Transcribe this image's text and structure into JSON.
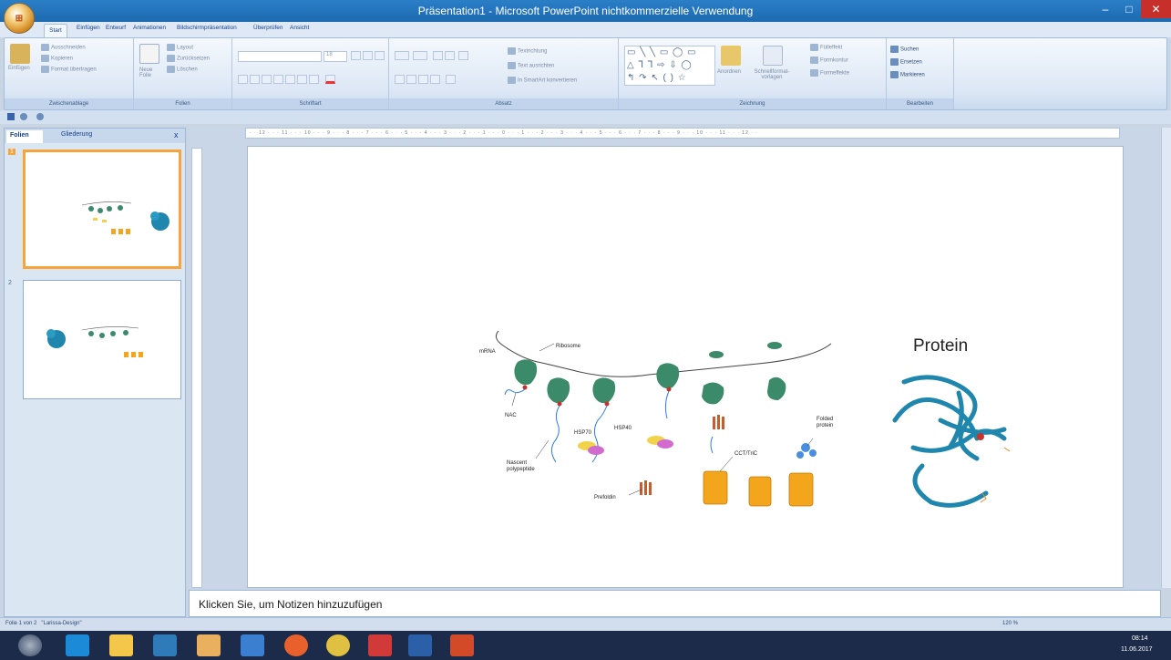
{
  "window": {
    "title": "Präsentation1 - Microsoft PowerPoint nichtkommerzielle Verwendung",
    "min": "–",
    "max": "□",
    "close": "✕",
    "office_logo": "⊞"
  },
  "tabs": [
    "Start",
    "Einfügen",
    "Entwurf",
    "Animationen",
    "Bildschirmpräsentation",
    "Überprüfen",
    "Ansicht"
  ],
  "ribbon": {
    "clipboard": {
      "paste": "Einfügen",
      "cut": "Ausschneiden",
      "copy": "Kopieren",
      "format": "Format übertragen",
      "label": "Zwischenablage"
    },
    "slides": {
      "new": "Neue Folie",
      "layout": "Layout",
      "reset": "Zurücksetzen",
      "delete": "Löschen",
      "label": "Folien"
    },
    "font": {
      "label": "Schriftart",
      "size": "18"
    },
    "paragraph": {
      "text_direction": "Textrichtung",
      "align_text": "Text ausrichten",
      "smartart": "In SmartArt konvertieren",
      "label": "Absatz"
    },
    "drawing": {
      "arrange": "Anordnen",
      "quick_styles": "Schnellformat-vorlagen",
      "fill": "Fülleffekt",
      "outline": "Formkontur",
      "effects": "Formeffekte",
      "label": "Zeichnung"
    },
    "editing": {
      "find": "Suchen",
      "replace": "Ersetzen",
      "select": "Markieren",
      "label": "Bearbeiten"
    }
  },
  "panel": {
    "tab_slides": "Folien",
    "tab_outline": "Gliederung",
    "close": "x",
    "thumbs": [
      "1",
      "2"
    ]
  },
  "ruler": "· · 12 · · · 11 · · · 10 · · · 9 · · · 8 · · · 7 · · · 6 · · · 5 · · · 4 · · · 3 · · · 2 · · · 1 · · · 0 · · · 1 · · · 2 · · · 3 · · · 4 · · · 5 · · · 6 · · · 7 · · · 8 · · · 9 · · · 10 · · · 11 · · · 12 · ·",
  "slide": {
    "protein_title": "Protein",
    "labels": {
      "mrna": "mRNA",
      "ribosome": "Ribosome",
      "nac": "NAC",
      "hsp70": "HSP70",
      "hsp40": "HSP40",
      "nascent": "Nascent polypeptide",
      "prefoldin": "Prefoldin",
      "cct": "CCT/TriC",
      "folded": "Folded protein"
    }
  },
  "notes": {
    "placeholder": "Klicken Sie, um Notizen hinzuzufügen"
  },
  "status": {
    "slide": "Folie 1 von 2",
    "theme": "\"Larissa-Design\"",
    "zoom": "120 %"
  },
  "tray": {
    "time": "08:14",
    "date": "11.06.2017"
  },
  "colors": {
    "title_bar": "#1d6ab0",
    "ribosome": "#3b8a6a",
    "protein": "#1f86ad",
    "cct": "#f3a51c",
    "hsp70": "#f0d34a",
    "hsp40": "#d16bd0"
  }
}
